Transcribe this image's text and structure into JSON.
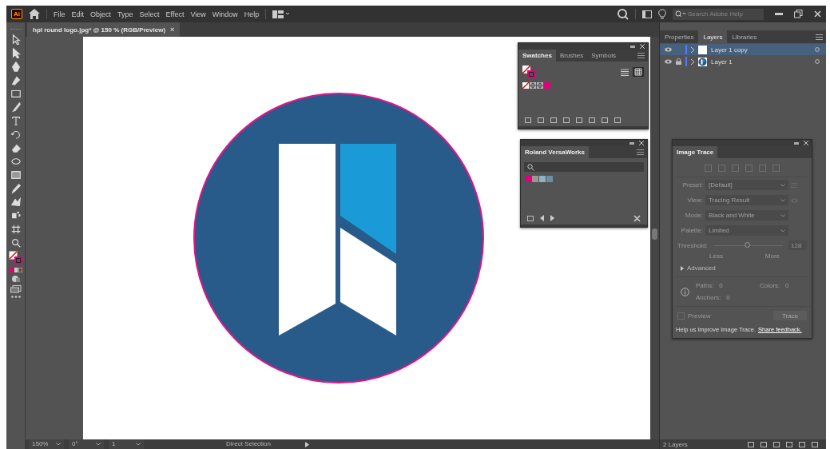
{
  "app_badge": "Ai",
  "menu": [
    "File",
    "Edit",
    "Object",
    "Type",
    "Select",
    "Effect",
    "View",
    "Window",
    "Help"
  ],
  "search": {
    "placeholder": "Search Adobe Help"
  },
  "document_tab": {
    "title": "hpl round logo.jpg* @ 150 % (RGB/Preview)",
    "close": "×"
  },
  "swatches_panel": {
    "tabs": [
      {
        "label": "Swatches",
        "selected": true
      },
      {
        "label": "Brushes",
        "selected": false
      },
      {
        "label": "Symbols",
        "selected": false
      }
    ],
    "swatches": [
      {
        "kind": "none"
      },
      {
        "kind": "registration"
      },
      {
        "kind": "registration"
      },
      {
        "kind": "color",
        "color": "#e0007a"
      }
    ]
  },
  "roland_panel": {
    "tabs": [
      {
        "label": "Roland VersaWorks",
        "selected": true
      }
    ],
    "swatches": [
      {
        "kind": "color",
        "color": "#e0007a"
      },
      {
        "kind": "color",
        "color": "#9a9693"
      },
      {
        "kind": "color",
        "color": "#8fb3c3"
      },
      {
        "kind": "color",
        "color": "#6d8fa3"
      }
    ]
  },
  "layers_panel": {
    "tabs": [
      {
        "label": "Properties",
        "selected": false
      },
      {
        "label": "Layers",
        "selected": true
      },
      {
        "label": "Libraries",
        "selected": false
      }
    ],
    "layers": [
      {
        "name": "Layer 1 copy",
        "selected": true,
        "locked": false
      },
      {
        "name": "Layer 1",
        "selected": false,
        "locked": true
      }
    ],
    "footer": "2 Layers"
  },
  "image_trace": {
    "title": "Image Trace",
    "fields": [
      {
        "label": "Preset:",
        "value": "[Default]"
      },
      {
        "label": "View:",
        "value": "Tracing Result"
      },
      {
        "label": "Mode:",
        "value": "Black and White"
      },
      {
        "label": "Palette:",
        "value": "Limited"
      }
    ],
    "threshold": {
      "label": "Threshold:",
      "level": 0.5,
      "value": "128",
      "min_label": "Less",
      "max_label": "More"
    },
    "advanced": "Advanced",
    "stats": [
      {
        "label": "Paths:",
        "value": "0"
      },
      {
        "label": "Colors:",
        "value": "0"
      },
      {
        "label": "Anchors:",
        "value": "0"
      }
    ],
    "preview": {
      "label": "Preview",
      "checked": false
    },
    "trace_button": "Trace",
    "help_text": "Help us improve Image Trace.",
    "feedback_link": "Share feedback."
  },
  "status": {
    "zoom": "150%",
    "rotation": "0°",
    "artboard": "1",
    "tool": "Direct Selection"
  }
}
